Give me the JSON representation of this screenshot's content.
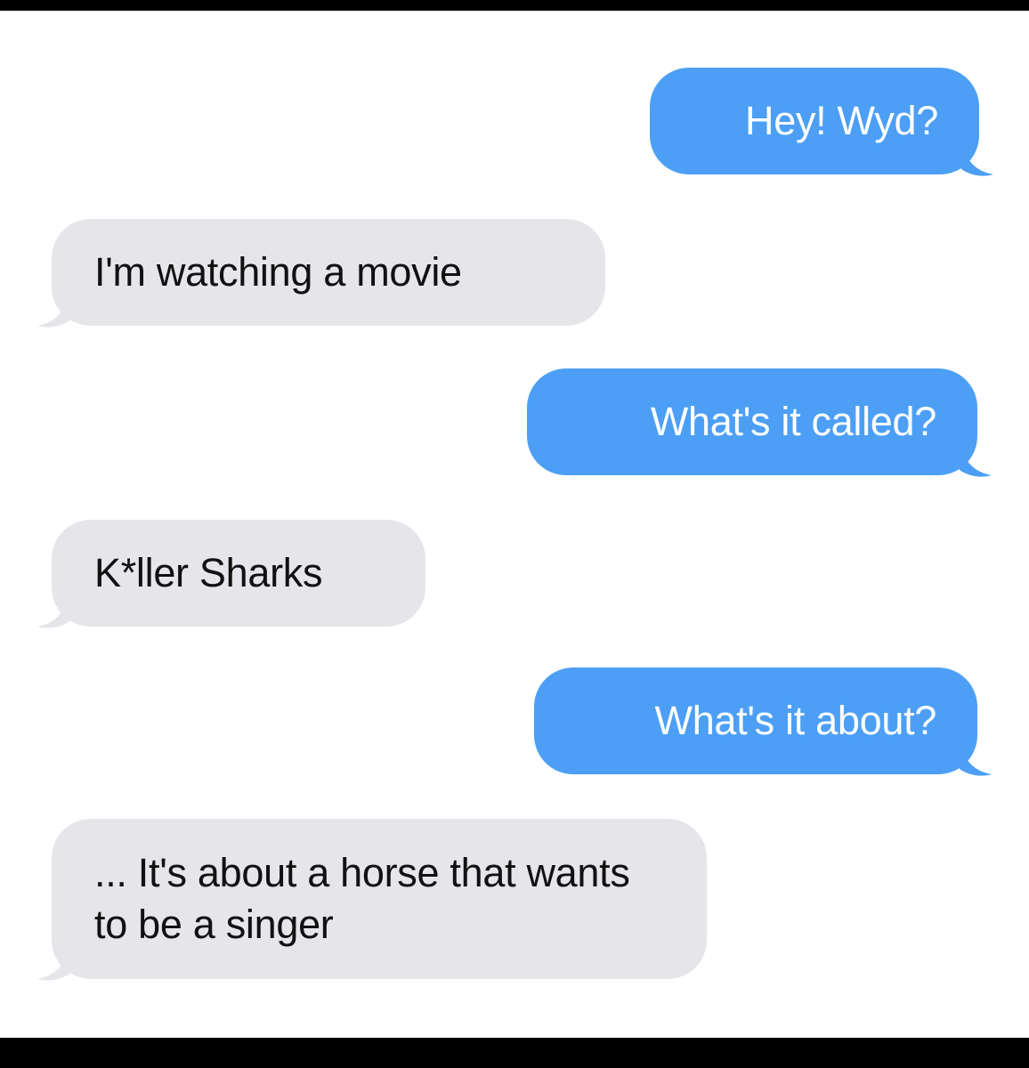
{
  "conversation": {
    "messages": [
      {
        "sender": "me",
        "text": "Hey! Wyd?"
      },
      {
        "sender": "them",
        "text": "I'm watching a movie"
      },
      {
        "sender": "me",
        "text": "What's it called?"
      },
      {
        "sender": "them",
        "text": "K*ller Sharks"
      },
      {
        "sender": "me",
        "text": "What's it about?"
      },
      {
        "sender": "them",
        "text": "... It's about a horse that wants to be a singer"
      }
    ]
  },
  "colors": {
    "sent_bubble": "#4c9ff5",
    "received_bubble": "#e5e5ea",
    "background": "#ffffff"
  }
}
